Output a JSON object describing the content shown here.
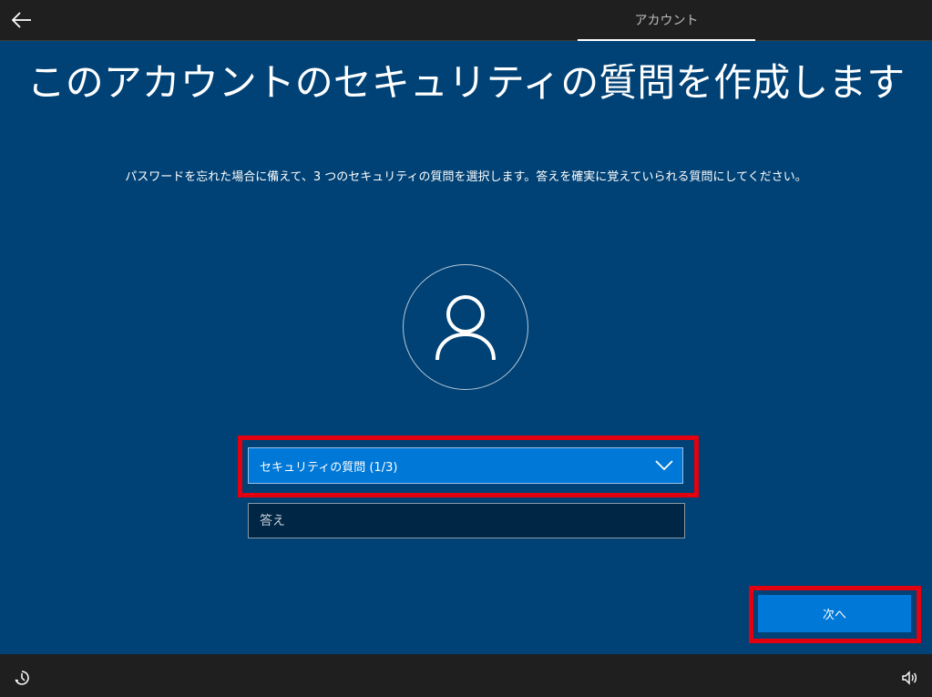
{
  "header": {
    "back_icon": "back-arrow-icon",
    "tab_label": "アカウント"
  },
  "main": {
    "title": "このアカウントのセキュリティの質問を作成します",
    "subtitle": "パスワードを忘れた場合に備えて、3 つのセキュリティの質問を選択します。答えを確実に覚えていられる質問にしてください。",
    "avatar_icon": "user-icon",
    "question_dropdown": {
      "selected": "セキュリティの質問 (1/3)",
      "icon": "chevron-down-icon"
    },
    "answer_field": {
      "placeholder": "答え",
      "value": ""
    },
    "next_label": "次へ"
  },
  "footer": {
    "accessibility_icon": "ease-of-access-icon",
    "volume_icon": "volume-icon"
  },
  "colors": {
    "background": "#004275",
    "accent": "#0078d7",
    "highlight": "#e3000f",
    "bar": "#1f1f1f"
  }
}
